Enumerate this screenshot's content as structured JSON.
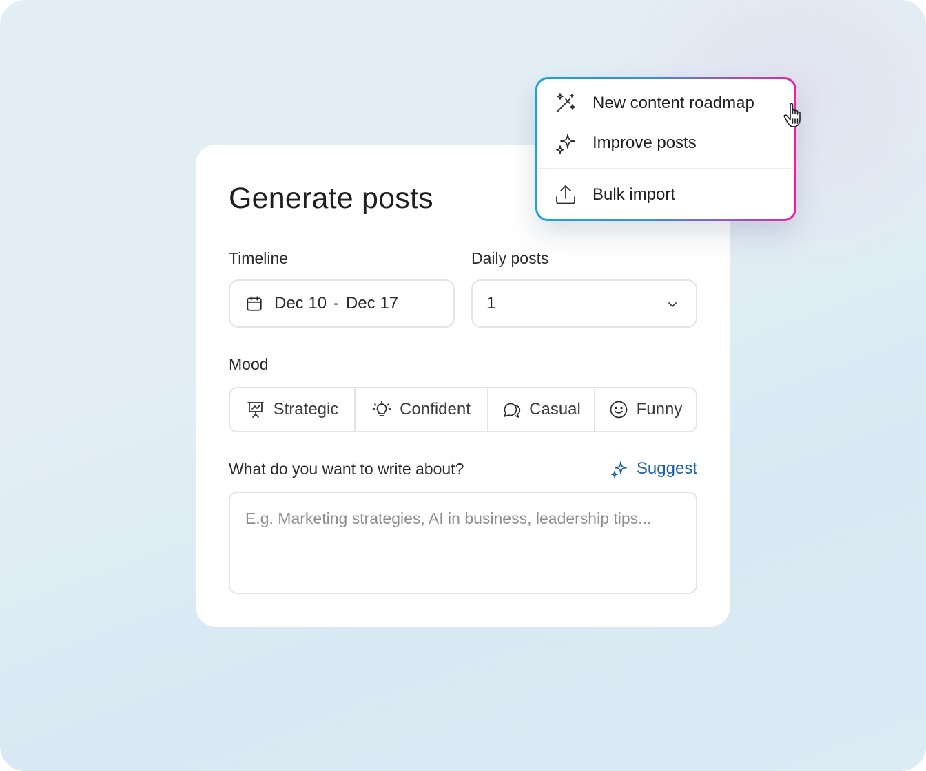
{
  "form": {
    "title": "Generate posts",
    "timeline": {
      "label": "Timeline",
      "start": "Dec 10",
      "separator": "-",
      "end": "Dec 17"
    },
    "daily_posts": {
      "label": "Daily posts",
      "value": "1"
    },
    "mood": {
      "label": "Mood",
      "options": [
        {
          "label": "Strategic",
          "icon": "presentation-icon"
        },
        {
          "label": "Confident",
          "icon": "lightbulb-icon"
        },
        {
          "label": "Casual",
          "icon": "chat-bubbles-icon"
        },
        {
          "label": "Funny",
          "icon": "smile-icon"
        }
      ]
    },
    "topic": {
      "label": "What do you want to write about?",
      "suggest_label": "Suggest",
      "placeholder": "E.g. Marketing strategies, AI in business, leadership tips..."
    }
  },
  "menu": {
    "items": [
      {
        "label": "New content roadmap",
        "icon": "magic-wand-icon"
      },
      {
        "label": "Improve posts",
        "icon": "sparkles-icon"
      },
      {
        "label": "Bulk import",
        "icon": "upload-icon"
      }
    ]
  },
  "colors": {
    "accent": "#1c5fae",
    "menu_gradient_start": "#1aa3e0",
    "menu_gradient_end": "#e8239e"
  }
}
